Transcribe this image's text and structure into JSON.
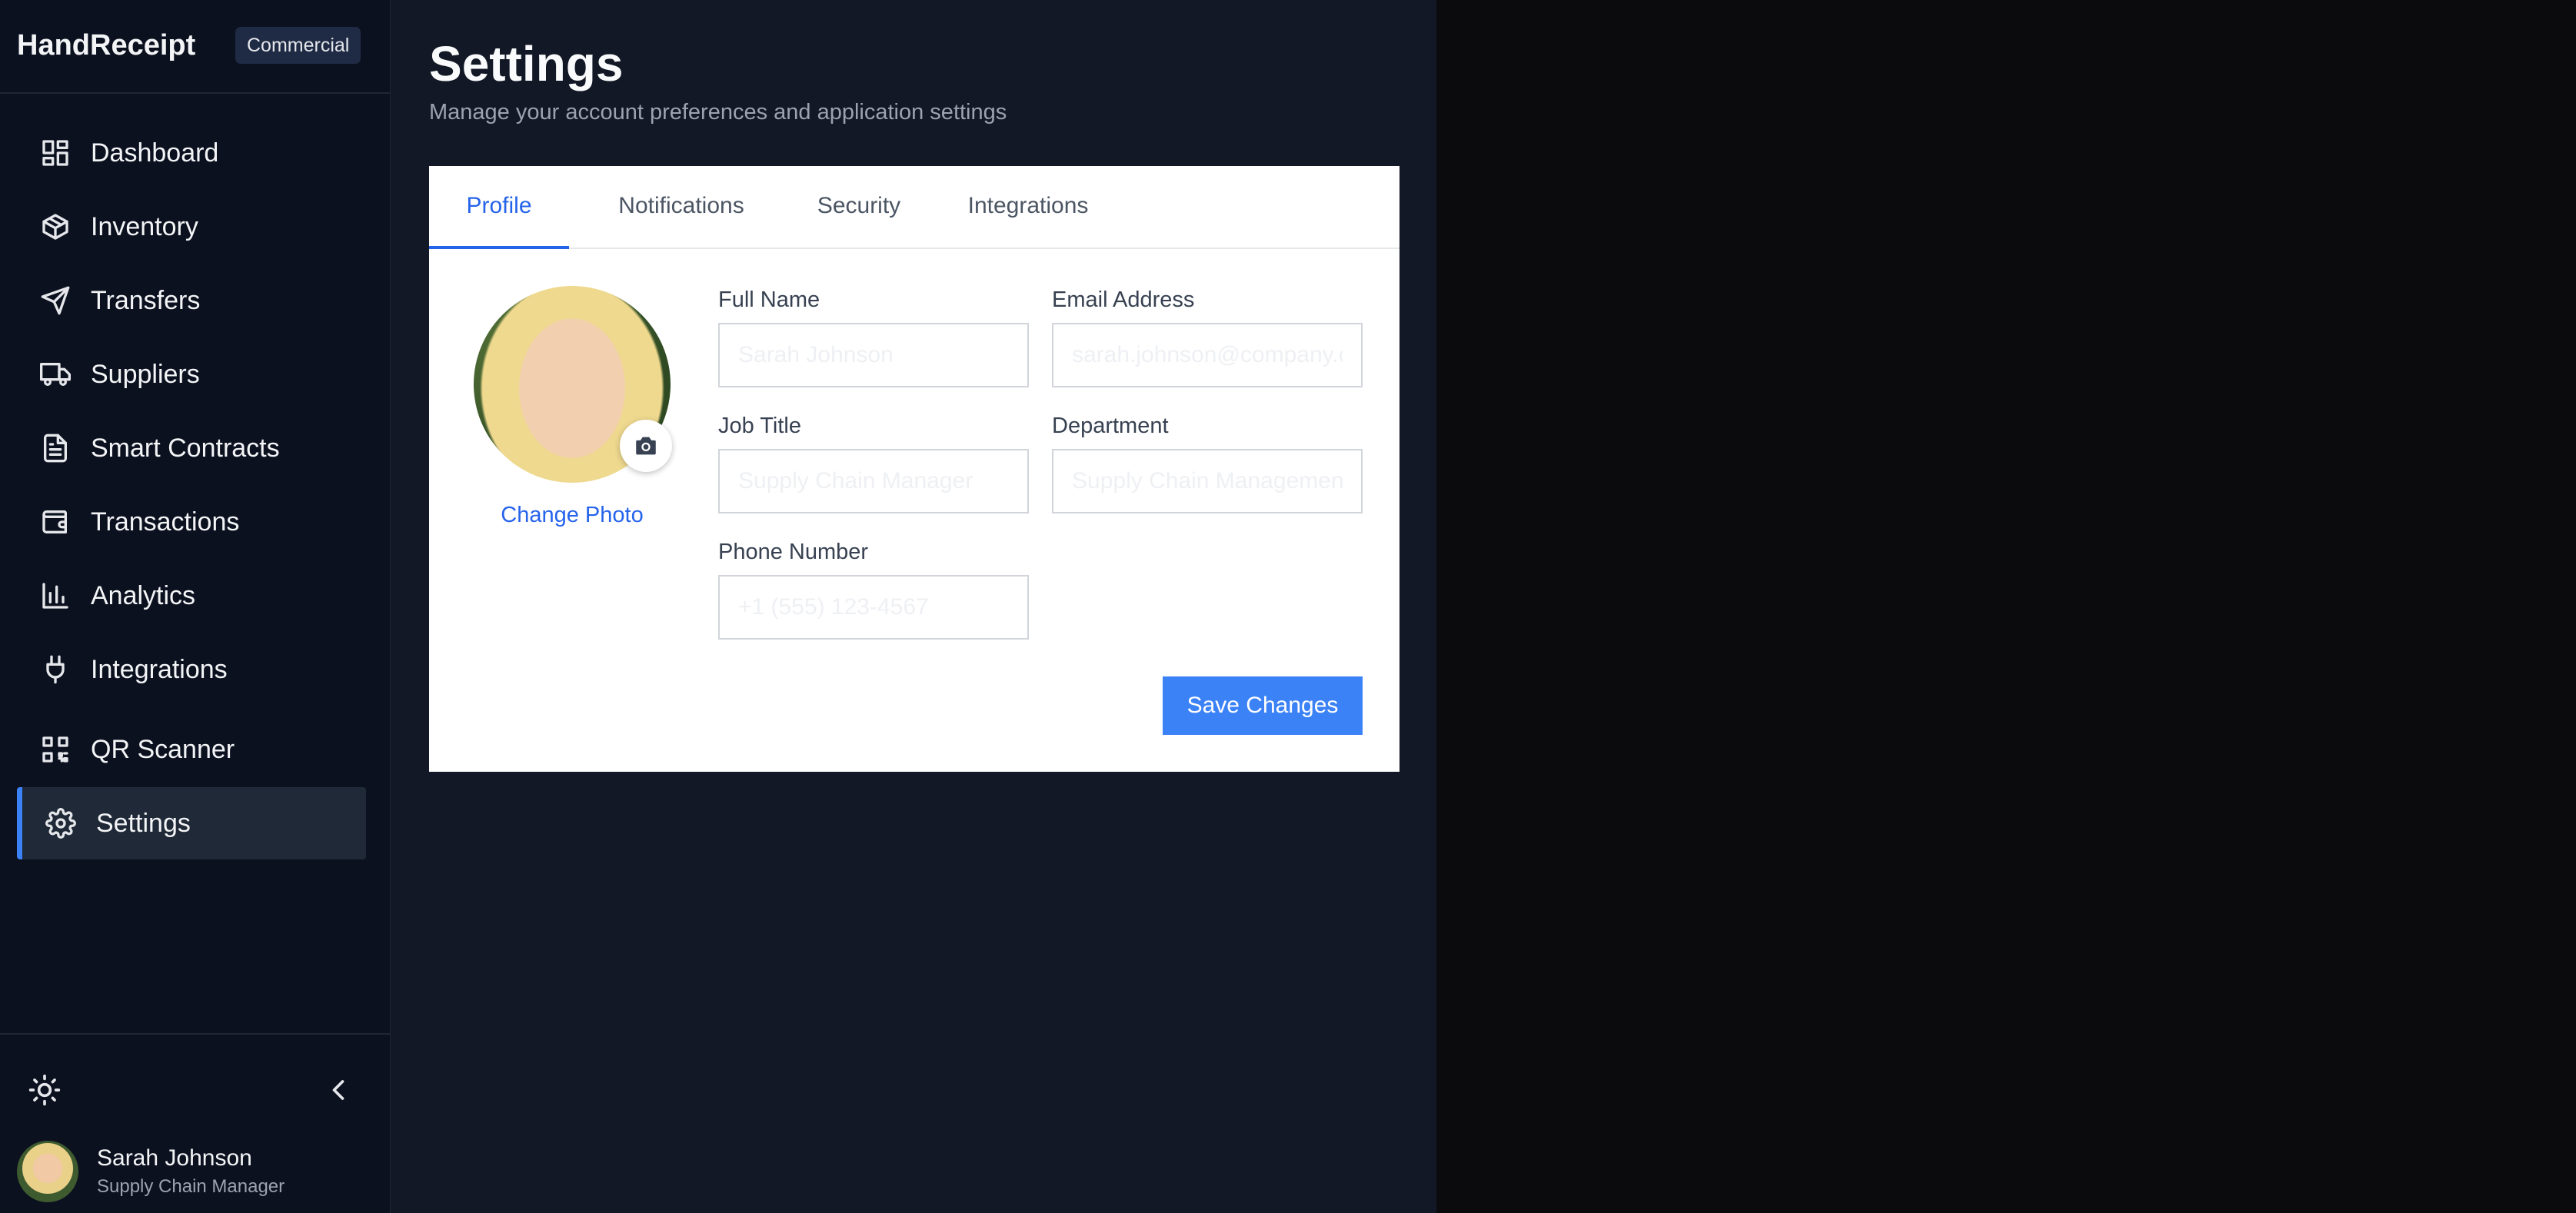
{
  "app": {
    "brand": "HandReceipt",
    "badge": "Commercial"
  },
  "sidebar": {
    "items": [
      {
        "label": "Dashboard",
        "icon": "dashboard-icon"
      },
      {
        "label": "Inventory",
        "icon": "package-icon"
      },
      {
        "label": "Transfers",
        "icon": "send-icon"
      },
      {
        "label": "Suppliers",
        "icon": "truck-icon"
      },
      {
        "label": "Smart Contracts",
        "icon": "file-text-icon"
      },
      {
        "label": "Transactions",
        "icon": "wallet-icon"
      },
      {
        "label": "Analytics",
        "icon": "bar-chart-icon"
      },
      {
        "label": "Integrations",
        "icon": "plug-icon"
      },
      {
        "label": "QR Scanner",
        "icon": "qr-code-icon"
      },
      {
        "label": "Settings",
        "icon": "gear-icon",
        "active": true
      }
    ],
    "user": {
      "name": "Sarah Johnson",
      "role": "Supply Chain Manager"
    }
  },
  "page": {
    "title": "Settings",
    "subtitle": "Manage your account preferences and application settings"
  },
  "tabs": [
    {
      "label": "Profile",
      "active": true
    },
    {
      "label": "Notifications"
    },
    {
      "label": "Security"
    },
    {
      "label": "Integrations"
    }
  ],
  "profile": {
    "change_photo": "Change Photo",
    "full_name": {
      "label": "Full Name",
      "placeholder": "Sarah Johnson",
      "value": ""
    },
    "email": {
      "label": "Email Address",
      "placeholder": "sarah.johnson@company.com",
      "value": ""
    },
    "job_title": {
      "label": "Job Title",
      "placeholder": "Supply Chain Manager",
      "value": ""
    },
    "department": {
      "label": "Department",
      "placeholder": "Supply Chain Management",
      "value": ""
    },
    "phone": {
      "label": "Phone Number",
      "placeholder": "+1 (555) 123-4567",
      "value": ""
    },
    "save_label": "Save Changes"
  },
  "colors": {
    "accent": "#3b82f6",
    "sidebar_bg": "#0c1120",
    "main_bg": "#121826"
  }
}
